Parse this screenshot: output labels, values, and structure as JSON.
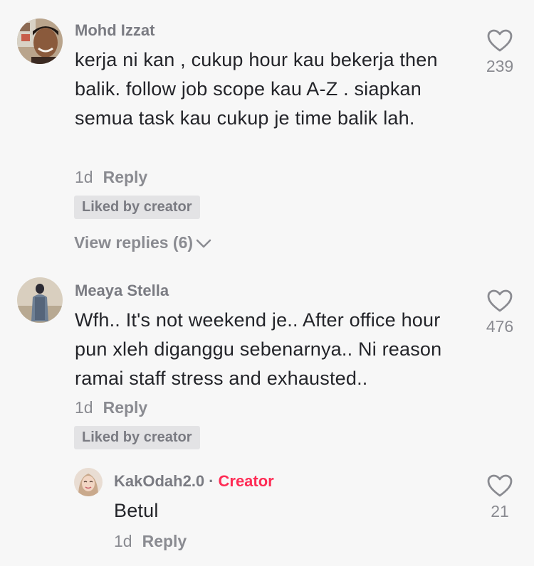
{
  "comments": [
    {
      "username": "Mohd Izzat",
      "text": "kerja ni kan , cukup hour kau bekerja then balik. follow job scope kau A-Z . siapkan semua task kau cukup je time balik lah.",
      "time": "1d",
      "reply_label": "Reply",
      "badge": "Liked by creator",
      "view_replies": "View replies (6)",
      "likes": "239"
    },
    {
      "username": "Meaya Stella",
      "text": "Wfh.. It's not weekend je.. After office hour pun xleh diganggu sebenarnya.. Ni reason ramai staff stress and exhausted..",
      "time": "1d",
      "reply_label": "Reply",
      "badge": "Liked by creator",
      "likes": "476"
    }
  ],
  "reply": {
    "username": "KakOdah2.0",
    "separator": "·",
    "creator_label": "Creator",
    "text": "Betul",
    "time": "1d",
    "reply_label": "Reply",
    "likes": "21"
  },
  "colors": {
    "background": "#f7f7f7",
    "creator_accent": "#fe2c55",
    "muted_text": "#8a8b91"
  },
  "icons": {
    "like": "heart-outline-icon",
    "expand": "chevron-down-icon"
  }
}
